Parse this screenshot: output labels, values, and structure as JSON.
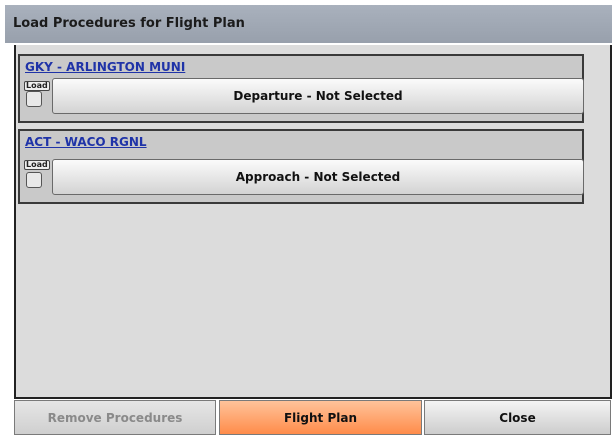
{
  "dialog": {
    "title": "Load Procedures for Flight Plan"
  },
  "airports": [
    {
      "id": "GKY - ARLINGTON MUNI",
      "load_label": "Load",
      "load_checked": false,
      "procedure_button": "Departure - Not Selected"
    },
    {
      "id": "ACT - WACO RGNL",
      "load_label": "Load",
      "load_checked": false,
      "procedure_button": "Approach - Not Selected"
    }
  ],
  "footer": {
    "remove_label": "Remove Procedures",
    "flight_plan_label": "Flight Plan",
    "close_label": "Close"
  },
  "colors": {
    "titlebar": "#a9b1bd",
    "link": "#1f33a8",
    "flight_plan_accent": "#ff8c4a"
  }
}
